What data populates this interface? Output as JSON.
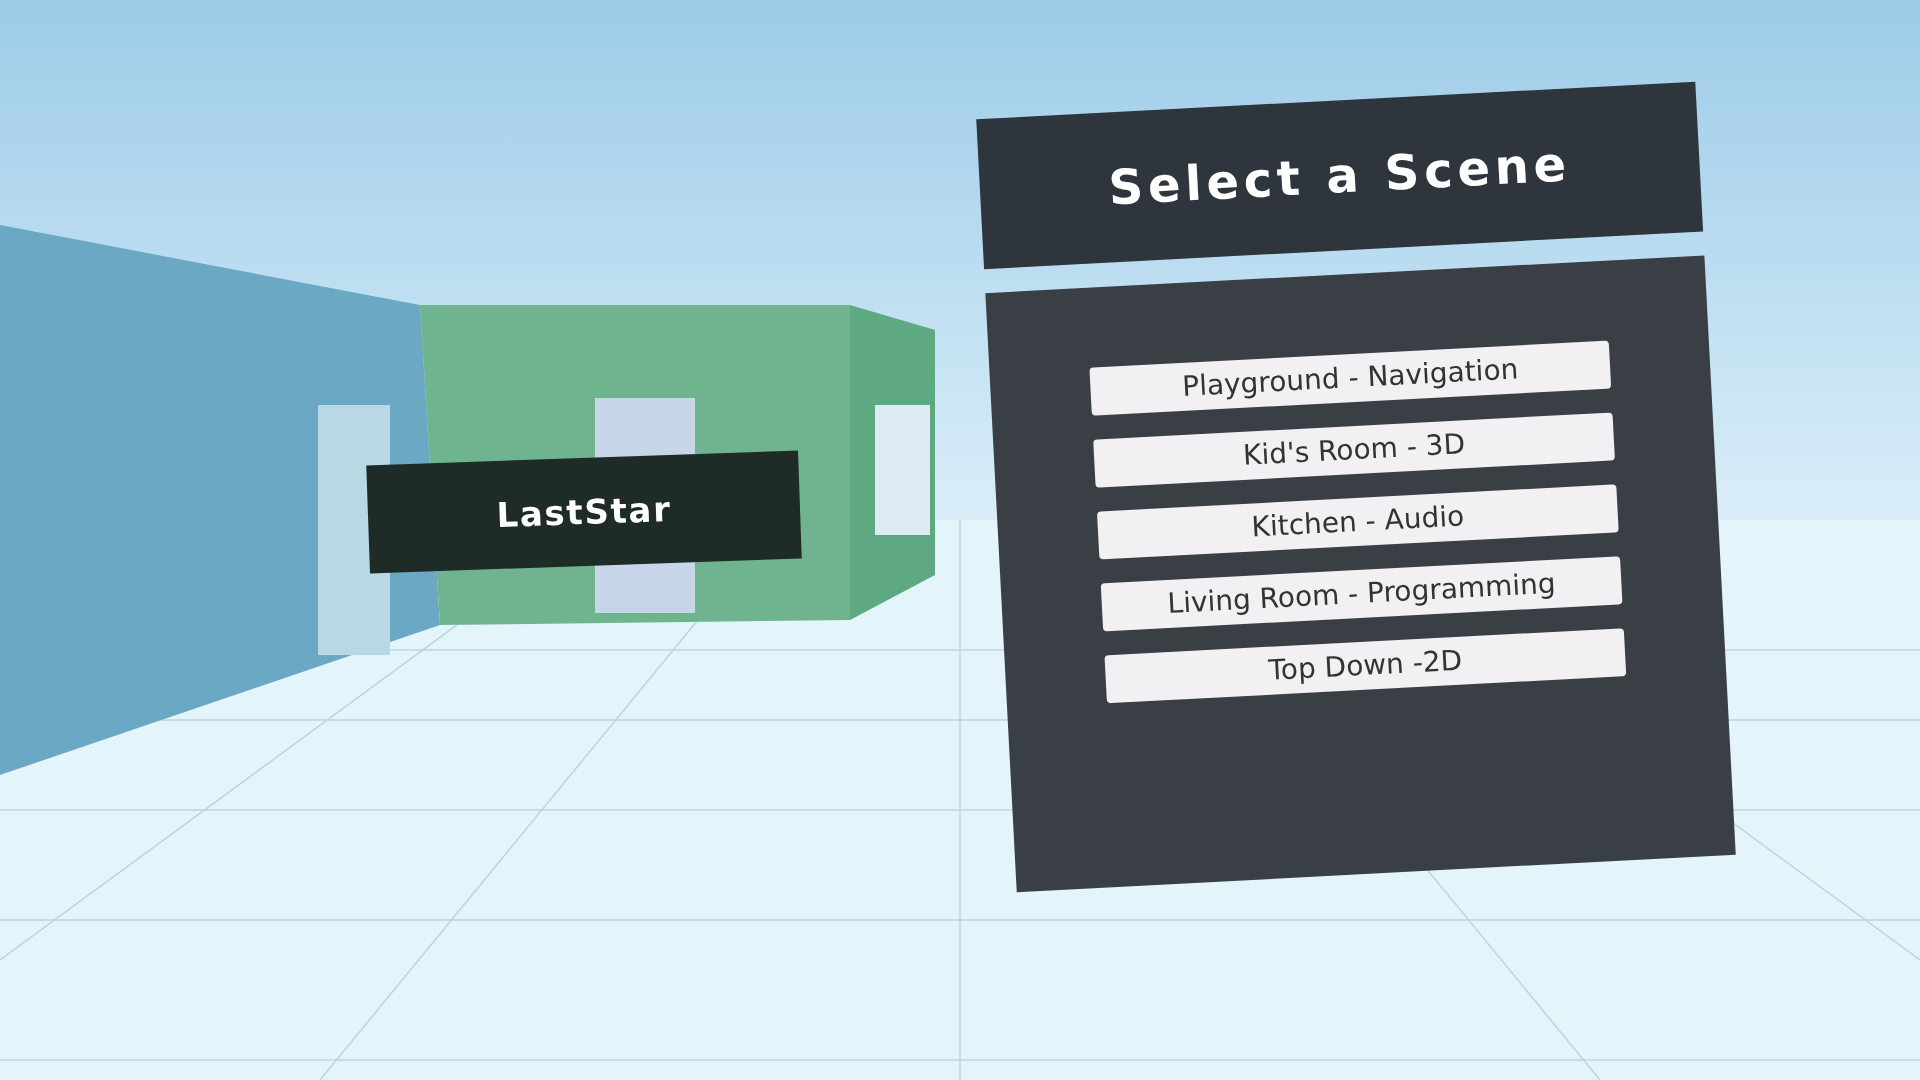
{
  "world_label": {
    "text": "LastStar"
  },
  "menu": {
    "title": "Select a Scene",
    "buttons": [
      {
        "label": "Playground - Navigation"
      },
      {
        "label": "Kid's Room - 3D"
      },
      {
        "label": "Kitchen - Audio"
      },
      {
        "label": "Living Room - Programming"
      },
      {
        "label": "Top Down -2D"
      }
    ]
  }
}
